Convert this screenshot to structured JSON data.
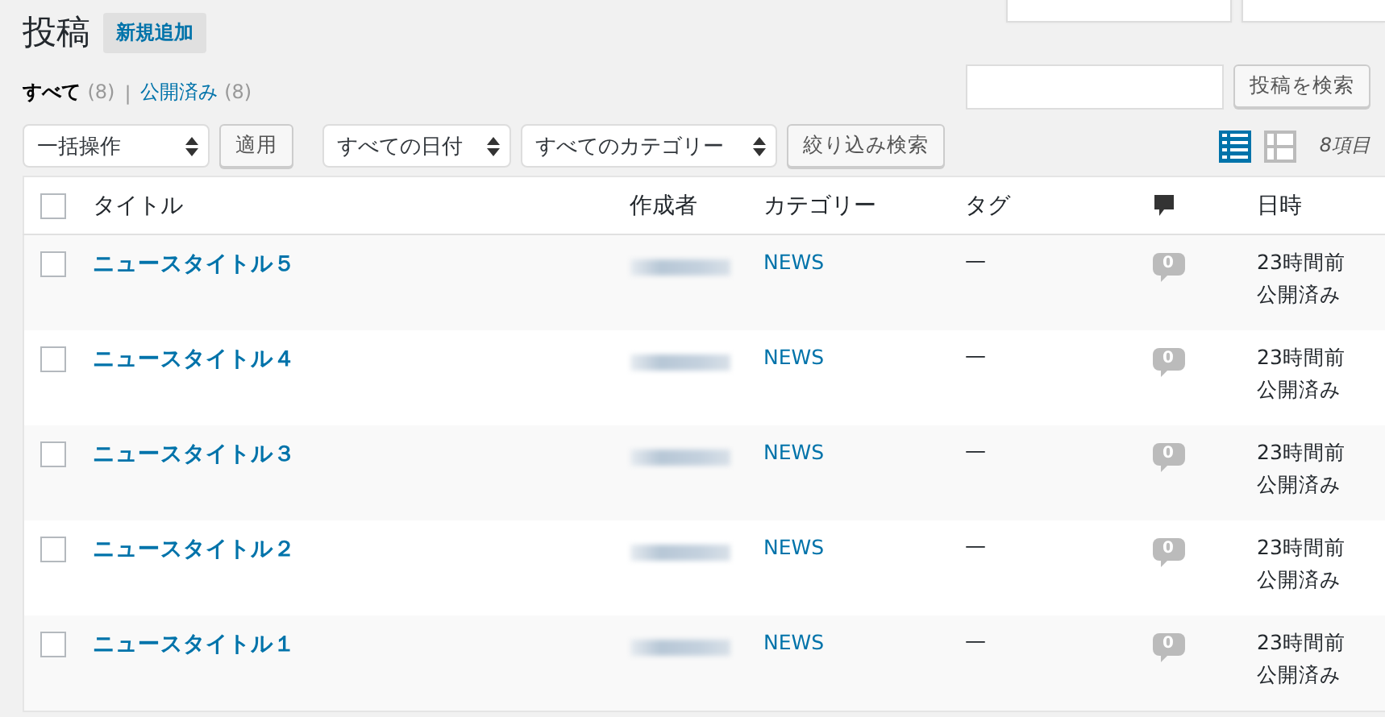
{
  "page_title": "投稿",
  "add_new": "新規追加",
  "views_separator": "|",
  "select_all_checked": false,
  "views": [
    {
      "label": "すべて",
      "count": "(8)",
      "selected": true
    },
    {
      "label": "公開済み",
      "count": "(8)",
      "selected": false
    }
  ],
  "search": {
    "button": "投稿を検索"
  },
  "bulk_action": {
    "select": "一括操作",
    "apply": "適用"
  },
  "filters": {
    "selects": [
      "すべての日付",
      "すべてのカテゴリー"
    ],
    "button": "絞り込み検索"
  },
  "view_modes": [
    {
      "kind": "list",
      "selected": true
    },
    {
      "kind": "excerpt",
      "selected": false
    }
  ],
  "item_count": "8項目",
  "columns": {
    "title": "タイトル",
    "author": "作成者",
    "category": "カテゴリー",
    "tags": "タグ",
    "date": "日時"
  },
  "rows": [
    {
      "title": "ニュースタイトル５",
      "category": "NEWS",
      "tags": "—",
      "comments": "0",
      "date": "23時間前",
      "status": "公開済み",
      "checked": false
    },
    {
      "title": "ニュースタイトル４",
      "category": "NEWS",
      "tags": "—",
      "comments": "0",
      "date": "23時間前",
      "status": "公開済み",
      "checked": false
    },
    {
      "title": "ニュースタイトル３",
      "category": "NEWS",
      "tags": "—",
      "comments": "0",
      "date": "23時間前",
      "status": "公開済み",
      "checked": false
    },
    {
      "title": "ニュースタイトル２",
      "category": "NEWS",
      "tags": "—",
      "comments": "0",
      "date": "23時間前",
      "status": "公開済み",
      "checked": false
    },
    {
      "title": "ニュースタイトル１",
      "category": "NEWS",
      "tags": "—",
      "comments": "0",
      "date": "23時間前",
      "status": "公開済み",
      "checked": false
    }
  ]
}
